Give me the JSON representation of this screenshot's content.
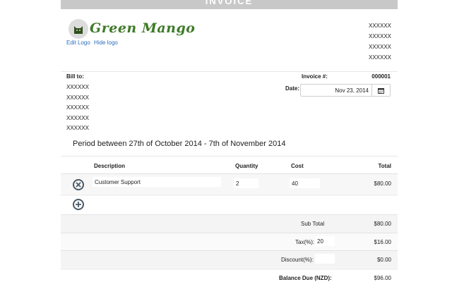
{
  "title": "INVOICE",
  "logo": {
    "text": "Green Mango",
    "edit_label": "Edit Logo",
    "hide_label": "Hide logo"
  },
  "company": [
    "XXXXXX",
    "XXXXXX",
    "XXXXXX",
    "XXXXXX"
  ],
  "bill_to": {
    "label": "Bill to:",
    "lines": [
      "XXXXXX",
      "XXXXXX",
      "XXXXXX",
      "XXXXXX",
      "XXXXXX"
    ]
  },
  "invoice": {
    "number_label": "Invoice #:",
    "number": "000001",
    "date_label": "Date:",
    "date": "Nov 23, 2014"
  },
  "period": "Period between 27th of October 2014 - 7th of November 2014",
  "table": {
    "headers": {
      "description": "Description",
      "quantity": "Quantity",
      "cost": "Cost",
      "total": "Total"
    },
    "rows": [
      {
        "description": "Customer Support",
        "quantity": "2",
        "cost": "40",
        "total": "$80.00"
      }
    ]
  },
  "totals": {
    "subtotal_label": "Sub Total",
    "subtotal": "$80.00",
    "tax_label": "Tax(%):",
    "tax_rate": "20",
    "tax": "$16.00",
    "discount_label": "Discount(%):",
    "discount_rate": "",
    "discount": "$0.00",
    "balance_label": "Balance Due (NZD):",
    "balance": "$96.00"
  },
  "colors": {
    "brand": "#3f7a2a",
    "link": "#2a6ebd",
    "icon": "#4a5a66"
  }
}
